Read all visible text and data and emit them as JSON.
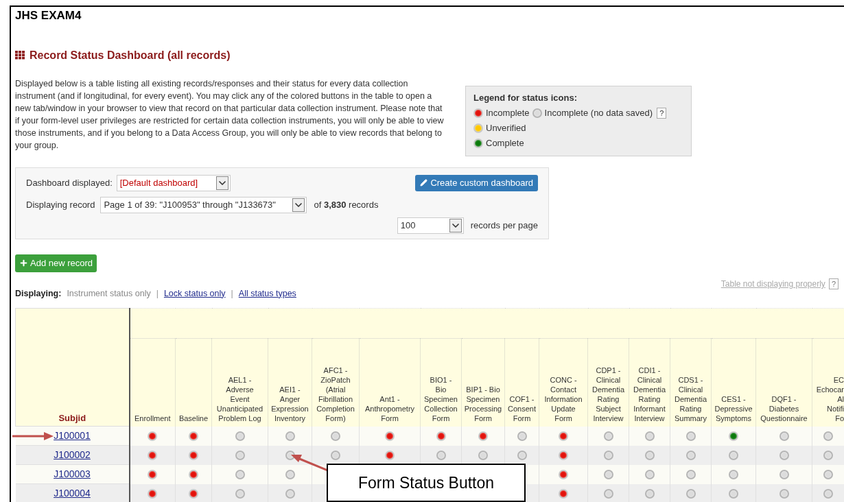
{
  "project_title": "JHS EXAM4",
  "page_heading": "Record Status Dashboard (all records)",
  "description": "Displayed below is a table listing all existing records/responses and their status for every data collection instrument (and if longitudinal, for every event). You may click any of the colored buttons in the table to open a new tab/window in your browser to view that record on that particular data collection instrument. Please note that if your form-level user privileges are restricted for certain data collection instruments, you will only be able to view those instruments, and if you belong to a Data Access Group, you will only be able to view records that belong to your group.",
  "legend": {
    "title": "Legend for status icons:",
    "rows": [
      [
        {
          "kind": "incomplete",
          "label": "Incomplete"
        },
        {
          "kind": "no_data",
          "label": "Incomplete (no data saved)",
          "help": "?"
        }
      ],
      [
        {
          "kind": "unverified",
          "label": "Unverified"
        }
      ],
      [
        {
          "kind": "complete",
          "label": "Complete"
        }
      ]
    ]
  },
  "controls": {
    "dashboard_label": "Dashboard displayed:",
    "dashboard_value": "[Default dashboard]",
    "create_button": "Create custom dashboard",
    "record_label": "Displaying record",
    "record_value": "Page 1 of 39: \"J100953\" through \"J133673\"",
    "record_count": "of **3,830** records",
    "per_page_value": "100",
    "per_page_label": "records per page"
  },
  "add_button": "Add new record",
  "table_help": {
    "label": "Table not displaying properly",
    "icon": "?"
  },
  "display_modes": {
    "label": "Displaying:",
    "separator": "|",
    "options": [
      {
        "label": "Instrument status only",
        "selected": true
      },
      {
        "label": "Lock status only",
        "selected": false
      },
      {
        "label": "All status types",
        "selected": false
      }
    ]
  },
  "table": {
    "id_column": "Subjid",
    "columns": [
      "Enrollment",
      "Baseline",
      "AEL1 -\nAdverse\nEvent\nUnanticipated\nProblem Log",
      "AEI1 -\nAnger\nExpression\nInventory",
      "AFC1 -\nZioPatch\n(Atrial\nFibrillation\nCompletion\nForm)",
      "Ant1 -\nAnthropometry\nForm",
      "BIO1 -\nBio\nSpecimen\nCollection\nForm",
      "BIP1 - Bio\nSpecimen\nProcessing\nForm",
      "COF1 -\nConsent\nForm",
      "CONC -\nContact\nInformation\nUpdate\nForm",
      "CDP1 -\nClinical\nDementia\nRating\nSubject\nInterview",
      "CDI1 -\nClinical\nDementia\nRating\nInformant\nInterview",
      "CDS1 -\nClinical\nDementia\nRating\nSummary",
      "CES1 -\nDepressive\nSymptoms",
      "DQF1 -\nDiabetes\nQuestionnaire",
      "EC\nEchocar\nAl\nNotifi\nFo"
    ],
    "rows": [
      {
        "id": "J100001",
        "cells": [
          {
            "kind": "incomplete"
          },
          {
            "kind": "incomplete"
          },
          {
            "kind": "no_data"
          },
          {
            "kind": "no_data"
          },
          {
            "kind": "no_data"
          },
          {
            "kind": "incomplete"
          },
          {
            "kind": "incomplete"
          },
          {
            "kind": "incomplete"
          },
          {
            "kind": "no_data"
          },
          {
            "kind": "incomplete"
          },
          {
            "kind": "no_data"
          },
          {
            "kind": "no_data"
          },
          {
            "kind": "no_data"
          },
          {
            "kind": "complete"
          },
          {
            "kind": "no_data"
          },
          {
            "kind": "no_data"
          }
        ]
      },
      {
        "id": "J100002",
        "cells": [
          {
            "kind": "incomplete"
          },
          {
            "kind": "incomplete"
          },
          {
            "kind": "no_data"
          },
          {
            "kind": "no_data"
          },
          {
            "kind": "no_data"
          },
          {
            "kind": "incomplete"
          },
          {
            "kind": "no_data"
          },
          {
            "kind": "no_data"
          },
          {
            "kind": "no_data"
          },
          {
            "kind": "incomplete"
          },
          {
            "kind": "no_data"
          },
          {
            "kind": "no_data"
          },
          {
            "kind": "no_data"
          },
          {
            "kind": "no_data"
          },
          {
            "kind": "no_data"
          },
          {
            "kind": "no_data"
          }
        ]
      },
      {
        "id": "J100003",
        "cells": [
          {
            "kind": "incomplete"
          },
          {
            "kind": "incomplete"
          },
          {
            "kind": "no_data"
          },
          {
            "kind": "no_data"
          },
          {
            "kind": "hidden"
          },
          {
            "kind": "hidden"
          },
          {
            "kind": "hidden"
          },
          {
            "kind": "hidden"
          },
          {
            "kind": "hidden"
          },
          {
            "kind": "incomplete"
          },
          {
            "kind": "no_data"
          },
          {
            "kind": "no_data"
          },
          {
            "kind": "no_data"
          },
          {
            "kind": "no_data"
          },
          {
            "kind": "no_data"
          },
          {
            "kind": "no_data"
          }
        ]
      },
      {
        "id": "J100004",
        "cells": [
          {
            "kind": "incomplete"
          },
          {
            "kind": "incomplete"
          },
          {
            "kind": "no_data"
          },
          {
            "kind": "no_data"
          },
          {
            "kind": "hidden"
          },
          {
            "kind": "hidden"
          },
          {
            "kind": "hidden"
          },
          {
            "kind": "hidden"
          },
          {
            "kind": "hidden"
          },
          {
            "kind": "incomplete"
          },
          {
            "kind": "no_data"
          },
          {
            "kind": "no_data"
          },
          {
            "kind": "no_data"
          },
          {
            "kind": "no_data"
          },
          {
            "kind": "no_data"
          },
          {
            "kind": "no_data"
          }
        ]
      }
    ]
  },
  "annotation": {
    "label": "Form Status Button"
  }
}
